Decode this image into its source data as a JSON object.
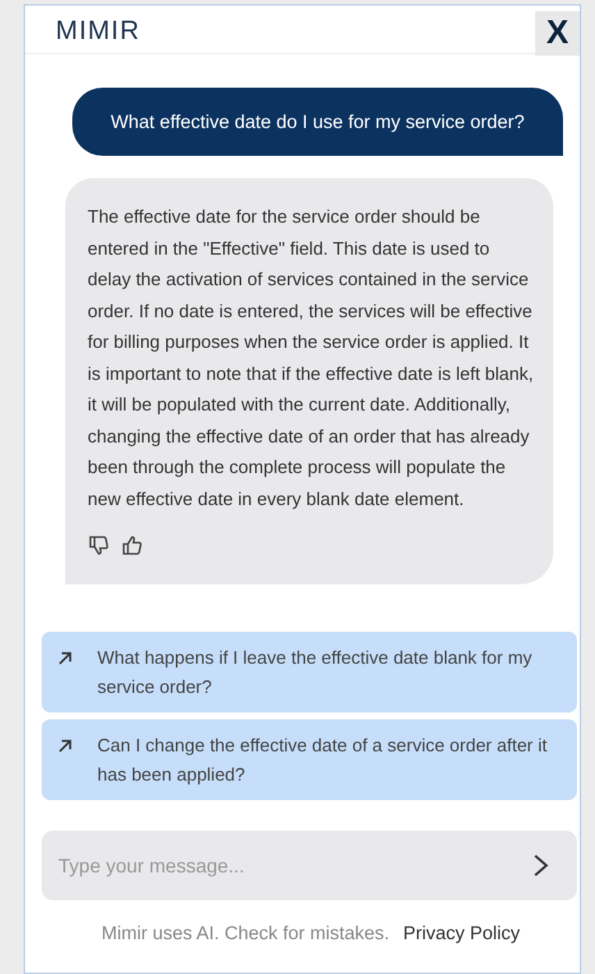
{
  "header": {
    "logo": "MIMIR",
    "close": "X"
  },
  "messages": [
    {
      "kind": "user",
      "text": "What effective date do I use for my service order?"
    },
    {
      "kind": "bot",
      "text": "The effective date for the service order should be entered in the \"Effective\" field. This date is used to delay the activation of services contained in the service order. If no date is entered, the services will be effective for billing purposes when the service order is applied. It is important to note that if the effective date is left blank, it will be populated with the current date. Additionally, changing the effective date of an order that has already been through the complete process will populate the new effective date in every blank date element."
    }
  ],
  "suggestions": [
    "What happens if I leave the effective date blank for my service order?",
    "Can I change the effective date of a service order after it has been applied?"
  ],
  "input": {
    "placeholder": "Type your message..."
  },
  "footer": {
    "note": "Mimir uses AI. Check for mistakes.",
    "link": "Privacy Policy"
  }
}
